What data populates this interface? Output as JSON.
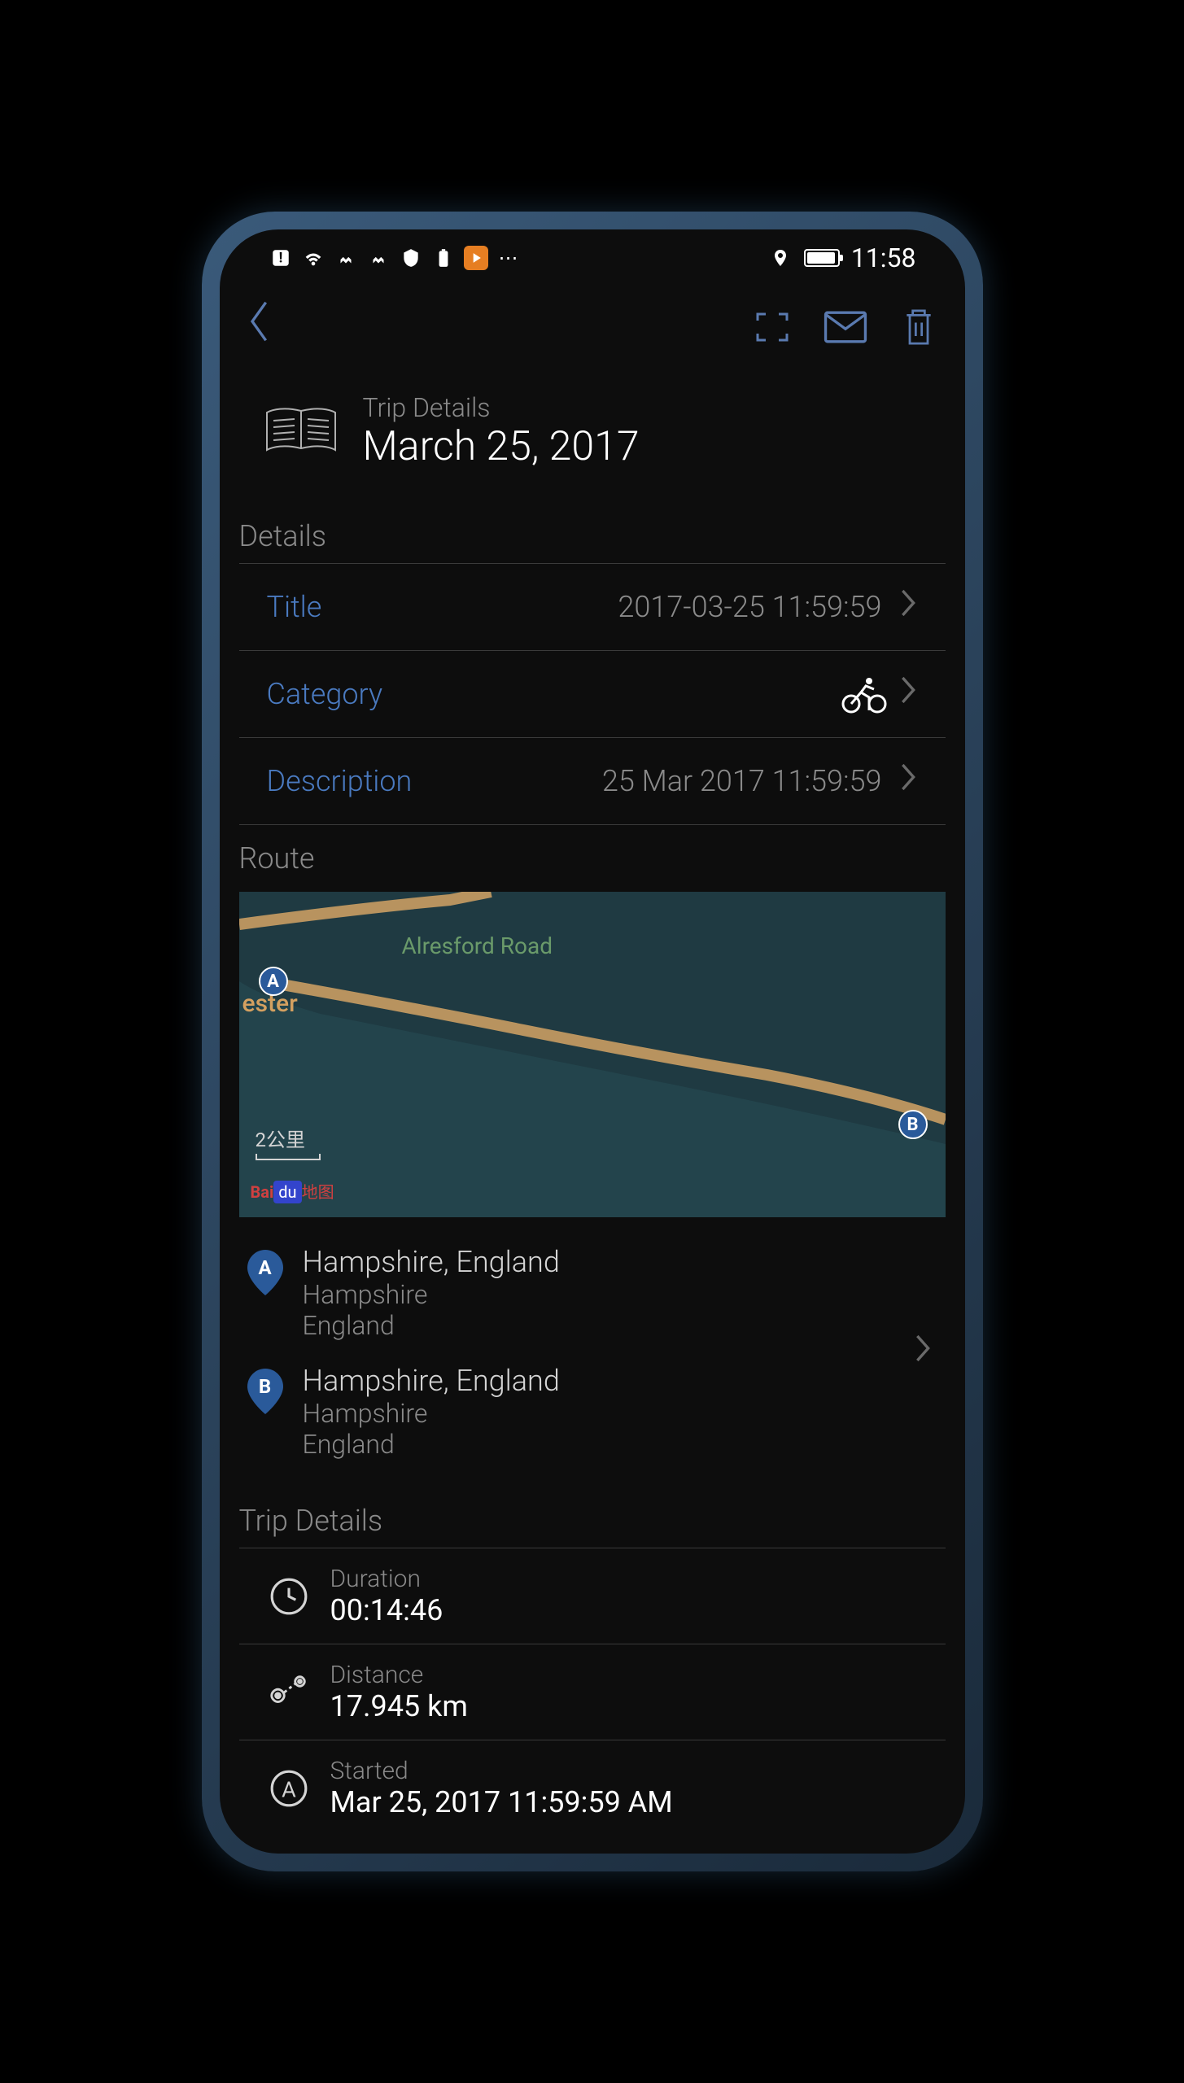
{
  "status_bar": {
    "time": "11:58"
  },
  "header": {
    "subtitle": "Trip Details",
    "title": "March 25, 2017"
  },
  "sections": {
    "details_label": "Details",
    "route_label": "Route",
    "trip_details_label": "Trip Details"
  },
  "details": {
    "title_label": "Title",
    "title_value": "2017-03-25 11:59:59",
    "category_label": "Category",
    "category_value": "cycling",
    "description_label": "Description",
    "description_value": "25 Mar 2017 11:59:59"
  },
  "map": {
    "road_label": "Alresford Road",
    "city_fragment": "ester",
    "scale": "2公里",
    "attribution": "Baidu"
  },
  "route": {
    "start": {
      "marker": "A",
      "name": "Hampshire, England",
      "region": "Hampshire",
      "country": "England"
    },
    "end": {
      "marker": "B",
      "name": "Hampshire, England",
      "region": "Hampshire",
      "country": "England"
    }
  },
  "stats": {
    "duration_label": "Duration",
    "duration_value": "00:14:46",
    "distance_label": "Distance",
    "distance_value": "17.945 km",
    "started_label": "Started",
    "started_value": "Mar 25, 2017 11:59:59 AM"
  }
}
